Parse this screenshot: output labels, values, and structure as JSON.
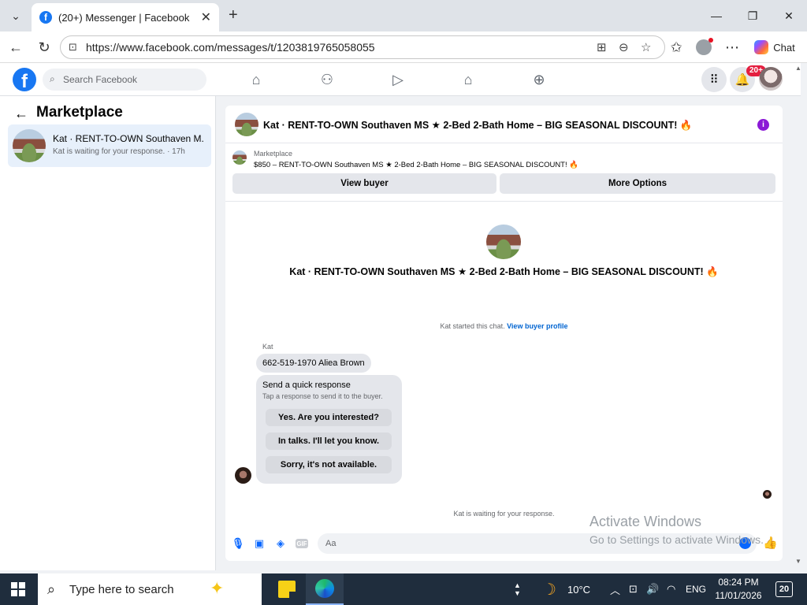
{
  "browser": {
    "tab_title": "(20+) Messenger | Facebook",
    "url": "https://www.facebook.com/messages/t/1203819765058055",
    "chat_label": "Chat"
  },
  "fb": {
    "search_placeholder": "Search Facebook",
    "notification_badge": "20+"
  },
  "sidebar": {
    "title": "Marketplace",
    "conversation": {
      "name": "Kat · RENT-TO-OWN Southaven M...",
      "preview": "Kat is waiting for your response. · 17h"
    }
  },
  "chat": {
    "header_title": "Kat · RENT-TO-OWN Southaven MS ★ 2-Bed 2-Bath Home – BIG SEASONAL DISCOUNT! 🔥",
    "marketplace_label": "Marketplace",
    "listing_title": "$850 – RENT-TO-OWN Southaven MS ★ 2-Bed 2-Bath Home – BIG SEASONAL DISCOUNT! 🔥",
    "view_buyer": "View buyer",
    "more_options": "More Options",
    "center_title": "Kat · RENT-TO-OWN Southaven MS ★ 2-Bed 2-Bath Home – BIG SEASONAL DISCOUNT! 🔥",
    "started_text": "Kat started this chat.",
    "view_buyer_profile": "View buyer profile",
    "sender_name": "Kat",
    "message": "662-519-1970 Aliea Brown",
    "quick_response_title": "Send a quick response",
    "quick_response_sub": "Tap a response to send it to the buyer.",
    "quick_options": [
      "Yes. Are you interested?",
      "In talks. I'll let you know.",
      "Sorry, it's not available."
    ],
    "waiting_text": "Kat is waiting for your response.",
    "composer_placeholder": "Aa"
  },
  "watermark": {
    "line1": "Activate Windows",
    "line2": "Go to Settings to activate Windows."
  },
  "taskbar": {
    "search_placeholder": "Type here to search",
    "temperature": "10°C",
    "language": "ENG",
    "time": "08:24 PM",
    "date": "11/01/2026",
    "notification_count": "20"
  }
}
